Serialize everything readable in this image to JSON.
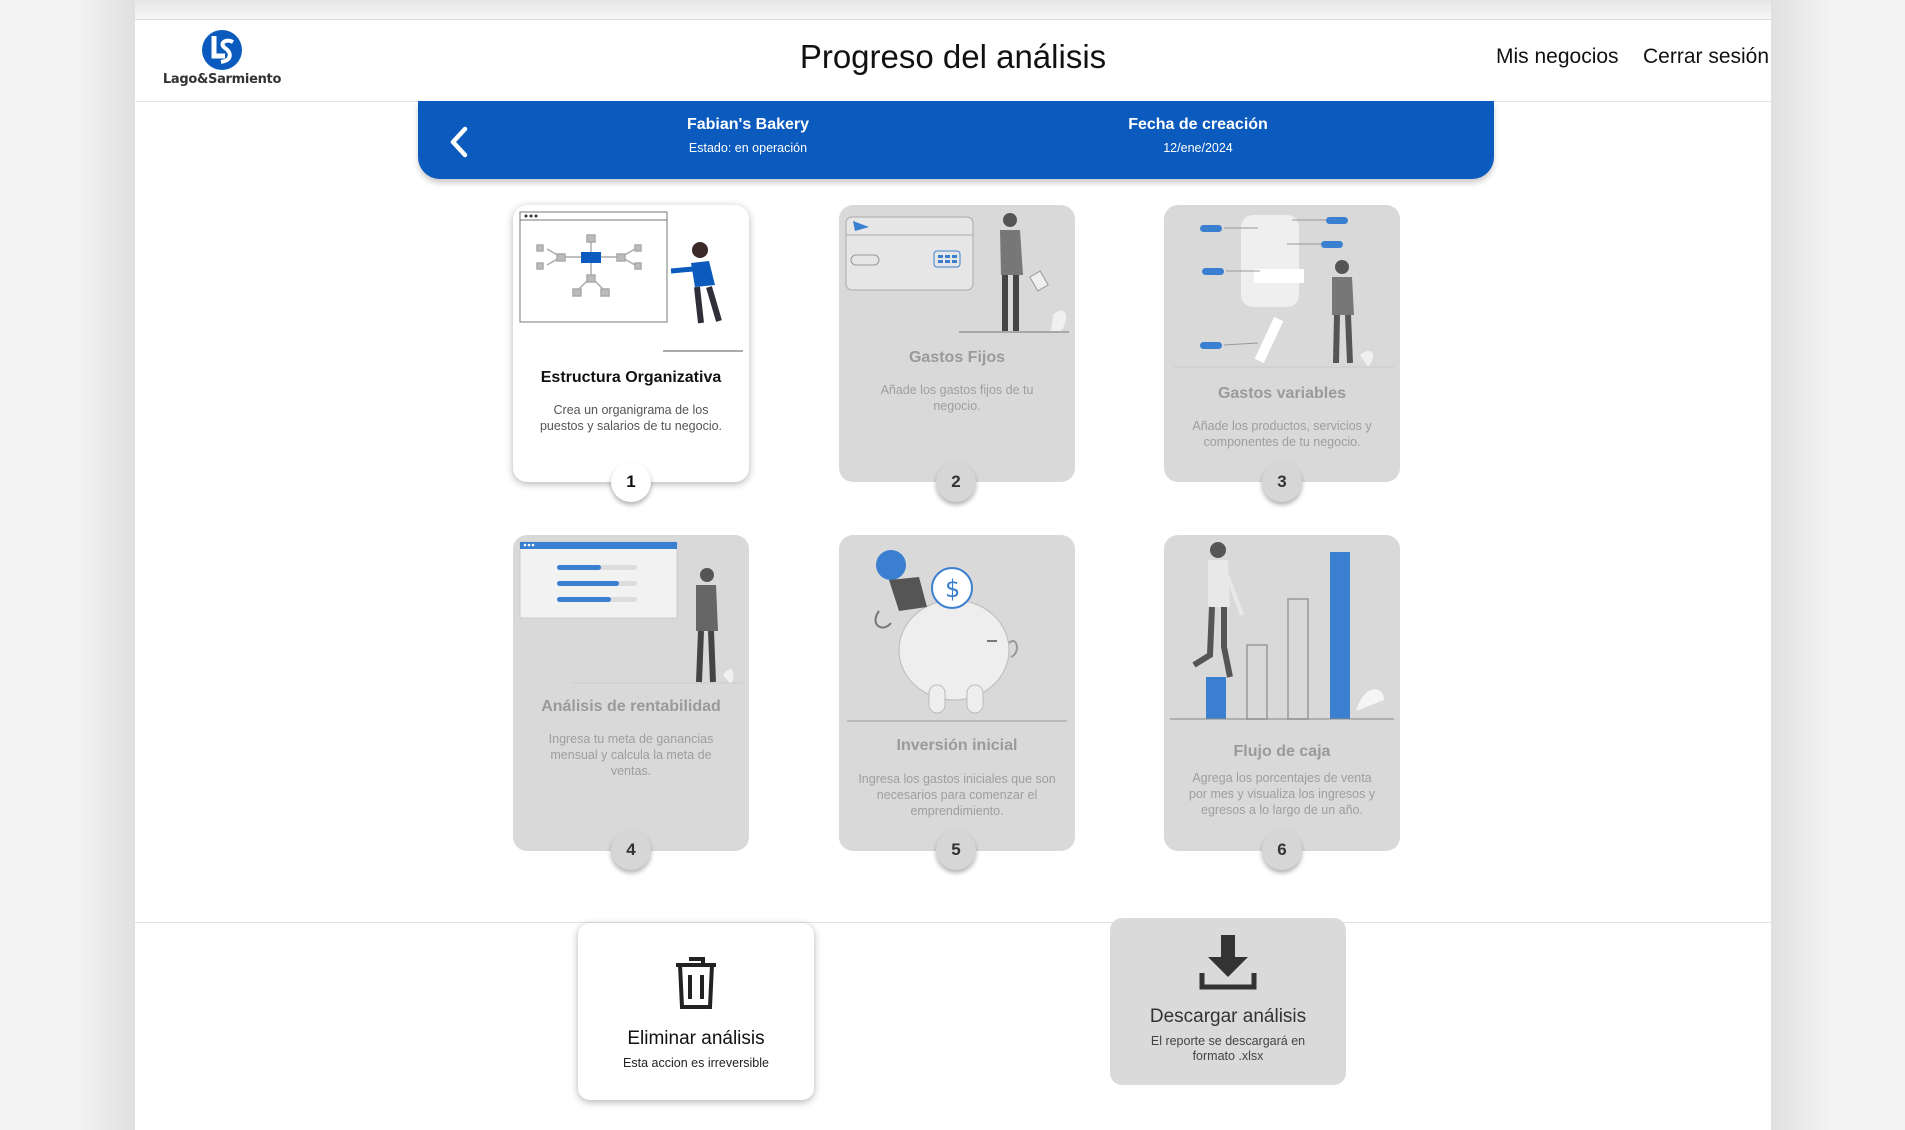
{
  "header": {
    "logo_text": "Lago&Sarmiento",
    "title": "Progreso del análisis",
    "nav": [
      "Mis negocios",
      "Cerrar sesión"
    ]
  },
  "business": {
    "name": "Fabian's Bakery",
    "status": "Estado: en operación",
    "date_label": "Fecha de creación",
    "date": "12/ene/2024"
  },
  "steps": [
    {
      "title": "Estructura Organizativa",
      "desc": "Crea un organigrama de los puestos y salarios de tu negocio.",
      "number": "1",
      "state": "active",
      "icon": "org-chart-illustration"
    },
    {
      "title": "Gastos Fijos",
      "desc": "Añade los gastos fijos de tu negocio.",
      "number": "2",
      "state": "locked",
      "icon": "credit-card-illustration"
    },
    {
      "title": "Gastos variables",
      "desc": "Añade los productos, servicios y componentes de tu negocio.",
      "number": "3",
      "state": "locked",
      "icon": "variable-costs-illustration"
    },
    {
      "title": "Análisis de rentabilidad",
      "desc": "Ingresa tu meta de ganancias mensual y calcula la meta de ventas.",
      "number": "4",
      "state": "locked",
      "icon": "profitability-illustration"
    },
    {
      "title": "Inversión inicial",
      "desc": "Ingresa los gastos iniciales que son necesarios para comenzar el emprendimiento.",
      "number": "5",
      "state": "locked",
      "icon": "piggy-bank-illustration"
    },
    {
      "title": "Flujo de caja",
      "desc": "Agrega los porcentajes de venta por mes y visualiza los ingresos y egresos a lo largo de un año.",
      "number": "6",
      "state": "locked",
      "icon": "cash-flow-bars-illustration"
    }
  ],
  "actions": {
    "delete_title": "Eliminar análisis",
    "delete_desc": "Esta accion es irreversible",
    "download_title": "Descargar análisis",
    "download_desc": "El reporte se descargará en formato .xlsx"
  },
  "colors": {
    "brand_blue": "#0a5bbd",
    "card_disabled": "#d9d9d9",
    "illustration_blue": "#3b7fd0"
  }
}
